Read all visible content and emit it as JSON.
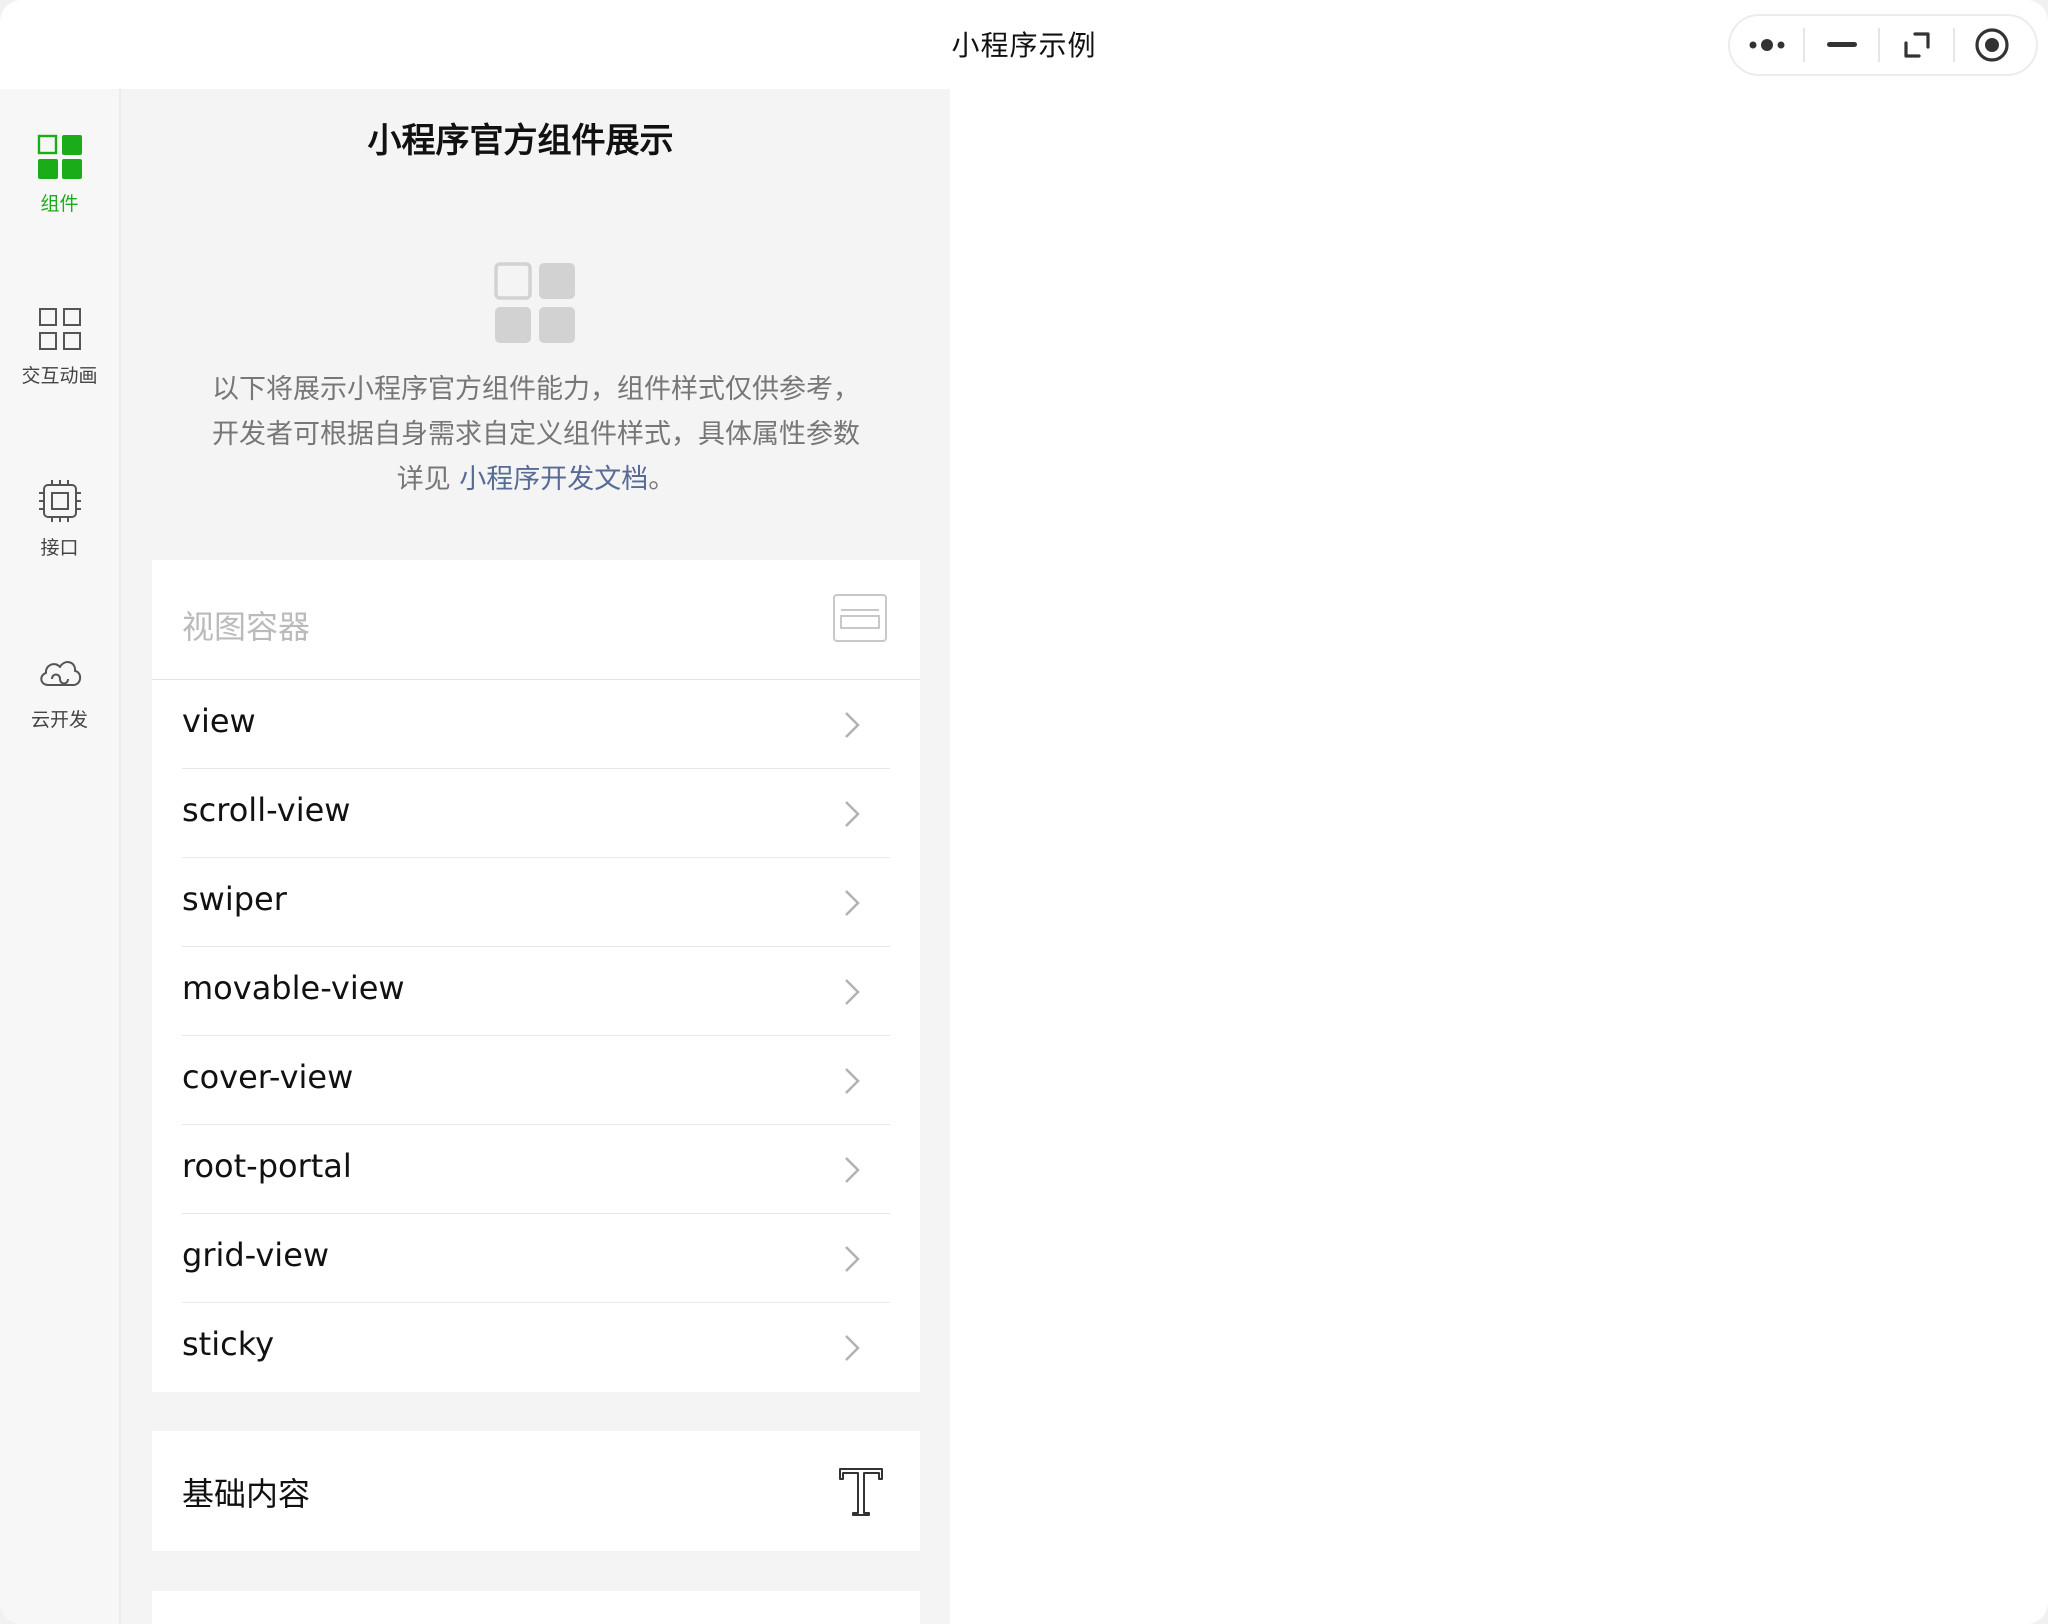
{
  "window": {
    "title": "小程序示例"
  },
  "capsule": {
    "buttons": [
      "more-icon",
      "minimize-icon",
      "restore-icon",
      "close-circle-icon"
    ]
  },
  "tabbar": {
    "active_color": "#1aad19",
    "items": [
      {
        "label": "组件",
        "icon": "components-grid-icon",
        "active": true
      },
      {
        "label": "交互动画",
        "icon": "interaction-grid-icon",
        "active": false
      },
      {
        "label": "接口",
        "icon": "chip-icon",
        "active": false
      },
      {
        "label": "云开发",
        "icon": "cloud-icon",
        "active": false
      }
    ]
  },
  "main": {
    "title": "小程序官方组件展示",
    "intro_text": "以下将展示小程序官方组件能力，组件样式仅供参考，开发者可根据自身需求自定义组件样式，具体属性参数详见 ",
    "doc_link": "小程序开发文档",
    "intro_end": "。",
    "link_color": "#576b95",
    "sections": [
      {
        "title": "视图容器",
        "icon": "view-container-icon",
        "expanded": true,
        "items": [
          "view",
          "scroll-view",
          "swiper",
          "movable-view",
          "cover-view",
          "root-portal",
          "grid-view",
          "sticky"
        ]
      },
      {
        "title": "基础内容",
        "icon": "text-t-icon",
        "expanded": false
      }
    ]
  }
}
